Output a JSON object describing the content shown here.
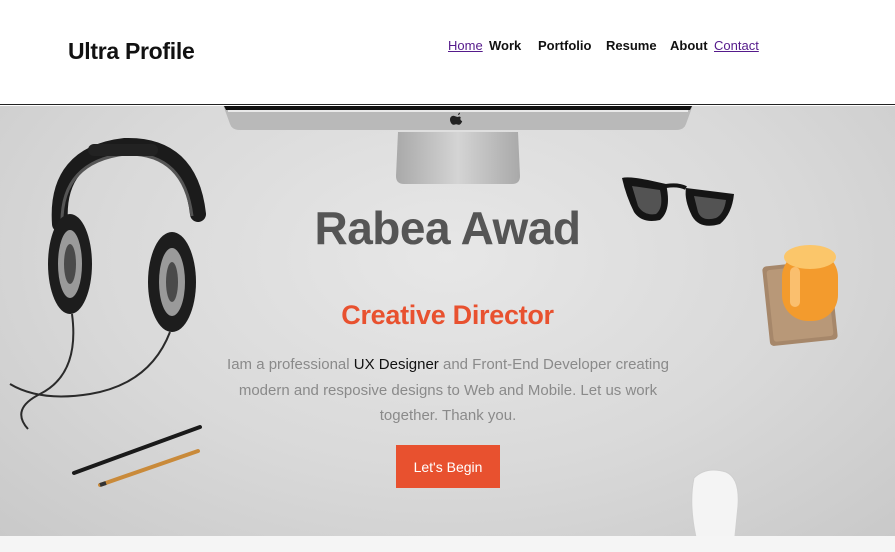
{
  "header": {
    "logo": "Ultra Profile",
    "nav": [
      {
        "label": "Home"
      },
      {
        "label": "Work"
      },
      {
        "label": "Portfolio"
      },
      {
        "label": "Resume"
      },
      {
        "label": "About"
      },
      {
        "label": "Contact"
      }
    ]
  },
  "hero": {
    "name": "Rabea Awad",
    "role": "Creative Director",
    "bio_prefix": "Iam a professional ",
    "bio_highlight": "UX Designer",
    "bio_suffix": " and Front-End Developer creating modern and resposive designs to Web and Mobile. Let us work together. Thank you.",
    "cta_label": "Let's Begin"
  },
  "colors": {
    "accent": "#e8512f",
    "name_text": "#555555",
    "body_text": "#8a8a8a",
    "visited_link": "#551a8b"
  }
}
